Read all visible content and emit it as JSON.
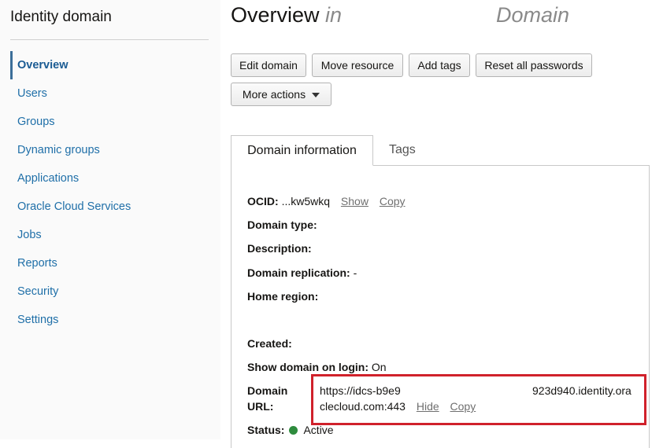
{
  "sidebar": {
    "title": "Identity domain",
    "items": [
      {
        "label": "Overview"
      },
      {
        "label": "Users"
      },
      {
        "label": "Groups"
      },
      {
        "label": "Dynamic groups"
      },
      {
        "label": "Applications"
      },
      {
        "label": "Oracle Cloud Services"
      },
      {
        "label": "Jobs"
      },
      {
        "label": "Reports"
      },
      {
        "label": "Security"
      },
      {
        "label": "Settings"
      }
    ],
    "active_item": "Overview"
  },
  "header": {
    "title": "Overview",
    "in_word": "in",
    "domain_word": "Domain"
  },
  "actions": {
    "edit_domain": "Edit domain",
    "move_resource": "Move resource",
    "add_tags": "Add tags",
    "reset_passwords": "Reset all passwords",
    "more_actions": "More actions"
  },
  "tabs": {
    "domain_information": "Domain information",
    "tags": "Tags"
  },
  "details": {
    "ocid_label": "OCID:",
    "ocid_value": "...kw5wkq",
    "show": "Show",
    "copy": "Copy",
    "domain_type_label": "Domain type:",
    "description_label": "Description:",
    "replication_label": "Domain replication:",
    "replication_value": "-",
    "home_region_label": "Home region:",
    "created_label": "Created:",
    "show_on_login_label": "Show domain on login:",
    "show_on_login_value": "On",
    "domain_url_label_1": "Domain",
    "domain_url_label_2": "URL:",
    "url_part_1": "https://idcs-b9e9",
    "url_part_2": "923d940.identity.ora",
    "url_part_3": "clecloud.com:443",
    "hide": "Hide",
    "status_label": "Status:",
    "status_value": "Active"
  },
  "colors": {
    "link": "#1f6fa8",
    "highlight_border": "#d0212b",
    "status_active": "#2e8b3d"
  }
}
